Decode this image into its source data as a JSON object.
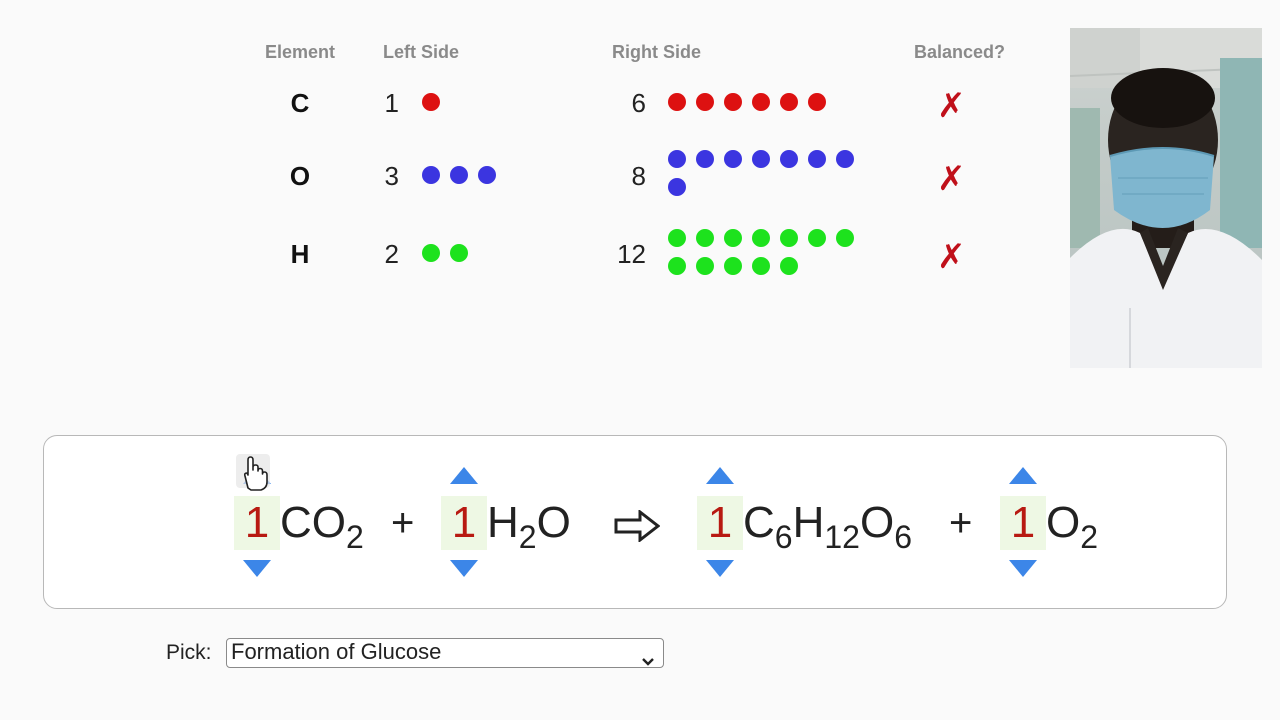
{
  "table": {
    "headers": {
      "element": "Element",
      "left": "Left Side",
      "right": "Right Side",
      "balanced": "Balanced?"
    },
    "rows": [
      {
        "element": "C",
        "left_count": "1",
        "right_count": "6",
        "color": "#dd1111",
        "balanced_mark": "✗"
      },
      {
        "element": "O",
        "left_count": "3",
        "right_count": "8",
        "color": "#3b35e0",
        "balanced_mark": "✗"
      },
      {
        "element": "H",
        "left_count": "2",
        "right_count": "12",
        "color": "#1de21d",
        "balanced_mark": "✗"
      }
    ]
  },
  "equation": {
    "terms": [
      {
        "coef": "1",
        "formula": [
          "C",
          "O",
          {
            "sub": "2"
          }
        ]
      },
      {
        "coef": "1",
        "formula": [
          "H",
          {
            "sub": "2"
          },
          "O"
        ]
      },
      {
        "coef": "1",
        "formula": [
          "C",
          {
            "sub": "6"
          },
          "H",
          {
            "sub": "12"
          },
          "O",
          {
            "sub": "6"
          }
        ]
      },
      {
        "coef": "1",
        "formula": [
          "O",
          {
            "sub": "2"
          }
        ]
      }
    ],
    "plus": "+",
    "arrow": "⇨"
  },
  "pick": {
    "label": "Pick:",
    "selected": "Formation of Glucose"
  },
  "colors": {
    "carbon": "#dd1111",
    "oxygen": "#3b35e0",
    "hydrogen": "#1de21d",
    "cross": "#c0101a",
    "coefficient": "#b81a12",
    "arrow_blue": "#3c86e8"
  },
  "icons": {
    "cross": "cross-mark-icon",
    "up": "increment-arrow-icon",
    "down": "decrement-arrow-icon",
    "cursor": "hand-pointer-icon",
    "select": "chevron-down-icon"
  }
}
